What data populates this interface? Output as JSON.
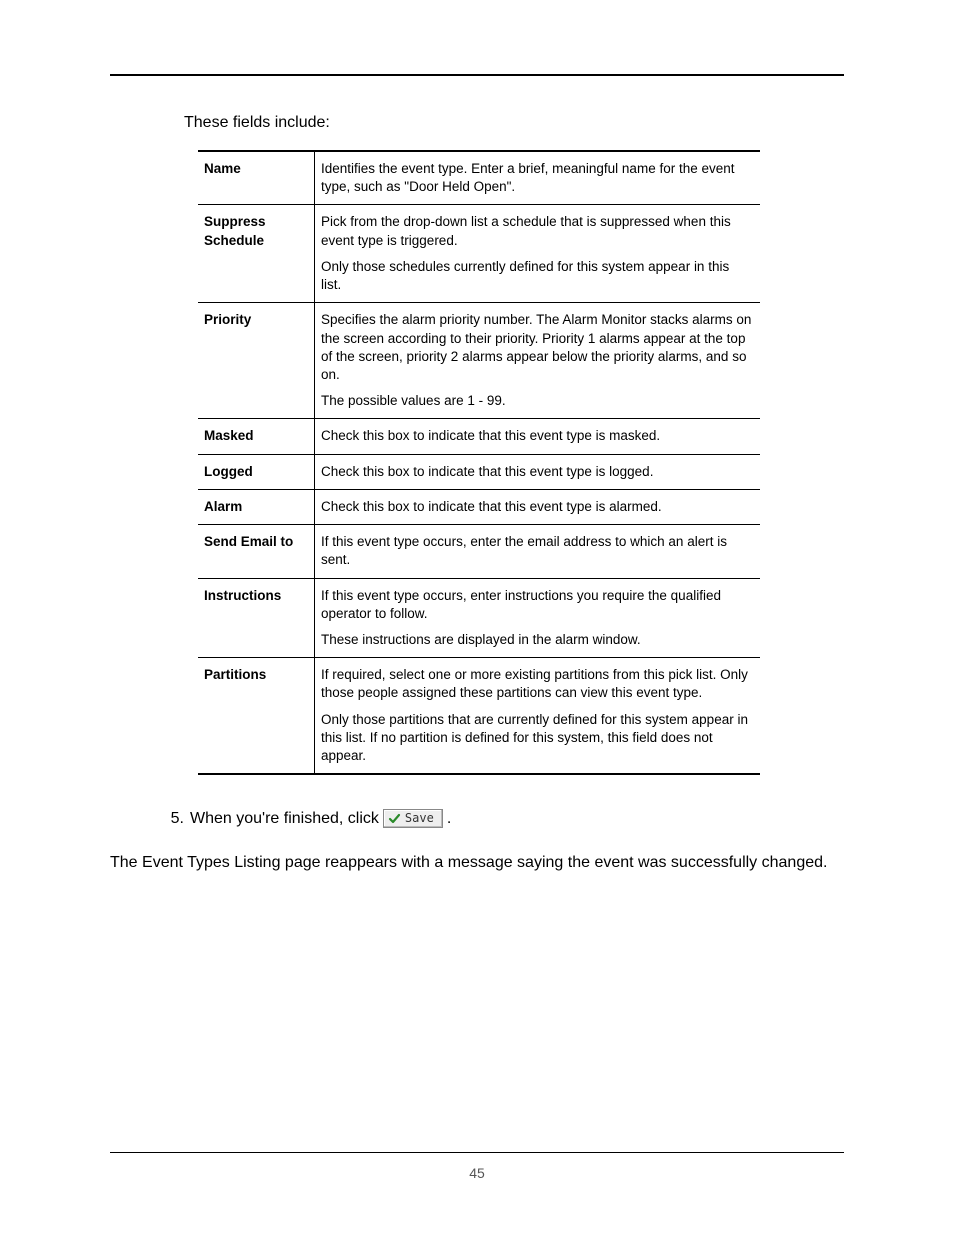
{
  "intro": "These fields include:",
  "table": {
    "rows": [
      {
        "label": "Name",
        "paras": [
          "Identifies the event type.  Enter a brief, meaningful name for the event type, such as \"Door Held Open\"."
        ]
      },
      {
        "label": "Suppress Schedule",
        "paras": [
          "Pick from the drop-down list a schedule that is suppressed when this event type is triggered.",
          "Only those schedules currently defined for this system appear in this list."
        ]
      },
      {
        "label": "Priority",
        "paras": [
          "Specifies the alarm priority number. The Alarm Monitor stacks alarms on the screen according to their priority. Priority 1 alarms appear at the top of the screen, priority 2 alarms appear below the priority alarms, and so on.",
          "The possible values are 1 - 99."
        ]
      },
      {
        "label": "Masked",
        "paras": [
          "Check this box to indicate that this event type is masked."
        ]
      },
      {
        "label": "Logged",
        "paras": [
          "Check this box to indicate that this event type is logged."
        ]
      },
      {
        "label": "Alarm",
        "paras": [
          "Check this box to indicate that this event type is alarmed."
        ]
      },
      {
        "label": "Send Email to",
        "paras": [
          "If this event type occurs, enter the email address to which an alert is sent."
        ]
      },
      {
        "label": "Instructions",
        "paras": [
          "If this event type occurs, enter instructions you require the qualified operator to follow.",
          "These instructions are displayed in the alarm window."
        ]
      },
      {
        "label": "Partitions",
        "paras": [
          "If required, select one or more existing partitions from this pick list. Only those people assigned these partitions can view this event type.",
          "Only those partitions that are currently defined for this system appear in this list. If no partition is defined for this system, this field does not appear."
        ]
      }
    ]
  },
  "step": {
    "number": "5.",
    "before": "When you're finished, click",
    "button_label": "Save",
    "after": "."
  },
  "closing": "The Event Types Listing page reappears with a message saying the event was successfully changed.",
  "page_number": "45"
}
